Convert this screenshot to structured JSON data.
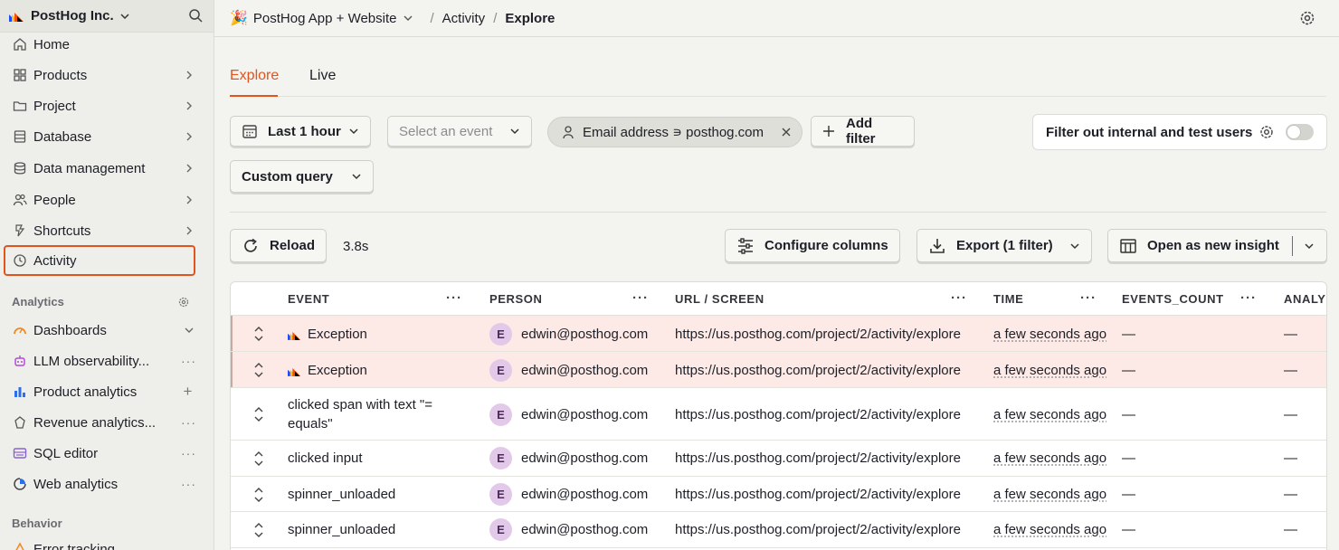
{
  "sidebar": {
    "org_name": "PostHog Inc.",
    "items": [
      {
        "label": "Home",
        "icon": "home-icon"
      },
      {
        "label": "Products",
        "icon": "grid-icon"
      },
      {
        "label": "Project",
        "icon": "folder-icon"
      },
      {
        "label": "Database",
        "icon": "database-icon"
      },
      {
        "label": "Data management",
        "icon": "cylinder-icon"
      },
      {
        "label": "People",
        "icon": "people-icon"
      },
      {
        "label": "Shortcuts",
        "icon": "shortcut-icon"
      },
      {
        "label": "Activity",
        "icon": "clock-icon"
      }
    ],
    "analytics_label": "Analytics",
    "analytics_items": [
      {
        "label": "Dashboards",
        "icon": "dashboard-icon"
      },
      {
        "label": "LLM observability...",
        "icon": "llm-icon"
      },
      {
        "label": "Product analytics",
        "icon": "bar-chart-icon"
      },
      {
        "label": "Revenue analytics...",
        "icon": "revenue-icon"
      },
      {
        "label": "SQL editor",
        "icon": "sql-icon"
      },
      {
        "label": "Web analytics",
        "icon": "web-icon"
      }
    ],
    "behavior_label": "Behavior",
    "behavior_items": [
      {
        "label": "Error tracking",
        "icon": "error-icon"
      }
    ]
  },
  "breadcrumb": {
    "emoji": "🎉",
    "project": "PostHog App + Website",
    "section": "Activity",
    "page": "Explore"
  },
  "tabs": [
    "Explore",
    "Live"
  ],
  "filters": {
    "time_range": "Last 1 hour",
    "event_placeholder": "Select an event",
    "pill": "Email address ∍ posthog.com",
    "add_filter": "Add filter",
    "internal_label": "Filter out internal and test users",
    "custom_query": "Custom query"
  },
  "toolbar": {
    "reload": "Reload",
    "duration": "3.8s",
    "configure": "Configure columns",
    "export": "Export (1 filter)",
    "open_insight": "Open as new insight"
  },
  "columns": [
    "EVENT",
    "PERSON",
    "URL / SCREEN",
    "TIME",
    "EVENTS_COUNT",
    "ANALY"
  ],
  "rows": [
    {
      "event": "Exception",
      "person": "edwin@posthog.com",
      "avatar": "E",
      "url": "https://us.posthog.com/project/2/activity/explore",
      "time": "a few seconds ago",
      "count": "—",
      "analy": "—"
    },
    {
      "event": "Exception",
      "person": "edwin@posthog.com",
      "avatar": "E",
      "url": "https://us.posthog.com/project/2/activity/explore",
      "time": "a few seconds ago",
      "count": "—",
      "analy": "—"
    },
    {
      "event_line1": "clicked span with text \"=",
      "event_line2": "equals\"",
      "person": "edwin@posthog.com",
      "avatar": "E",
      "url": "https://us.posthog.com/project/2/activity/explore",
      "time": "a few seconds ago",
      "count": "—",
      "analy": "—"
    },
    {
      "event": "clicked input",
      "person": "edwin@posthog.com",
      "avatar": "E",
      "url": "https://us.posthog.com/project/2/activity/explore",
      "time": "a few seconds ago",
      "count": "—",
      "analy": "—"
    },
    {
      "event": "spinner_unloaded",
      "person": "edwin@posthog.com",
      "avatar": "E",
      "url": "https://us.posthog.com/project/2/activity/explore",
      "time": "a few seconds ago",
      "count": "—",
      "analy": "—"
    },
    {
      "event": "spinner_unloaded",
      "person": "edwin@posthog.com",
      "avatar": "E",
      "url": "https://us.posthog.com/project/2/activity/explore",
      "time": "a few seconds ago",
      "count": "—",
      "analy": "—"
    }
  ],
  "colors": {
    "accent": "#e2541e",
    "error_row": "#fde9e6",
    "avatar": "#e3c9e9"
  }
}
